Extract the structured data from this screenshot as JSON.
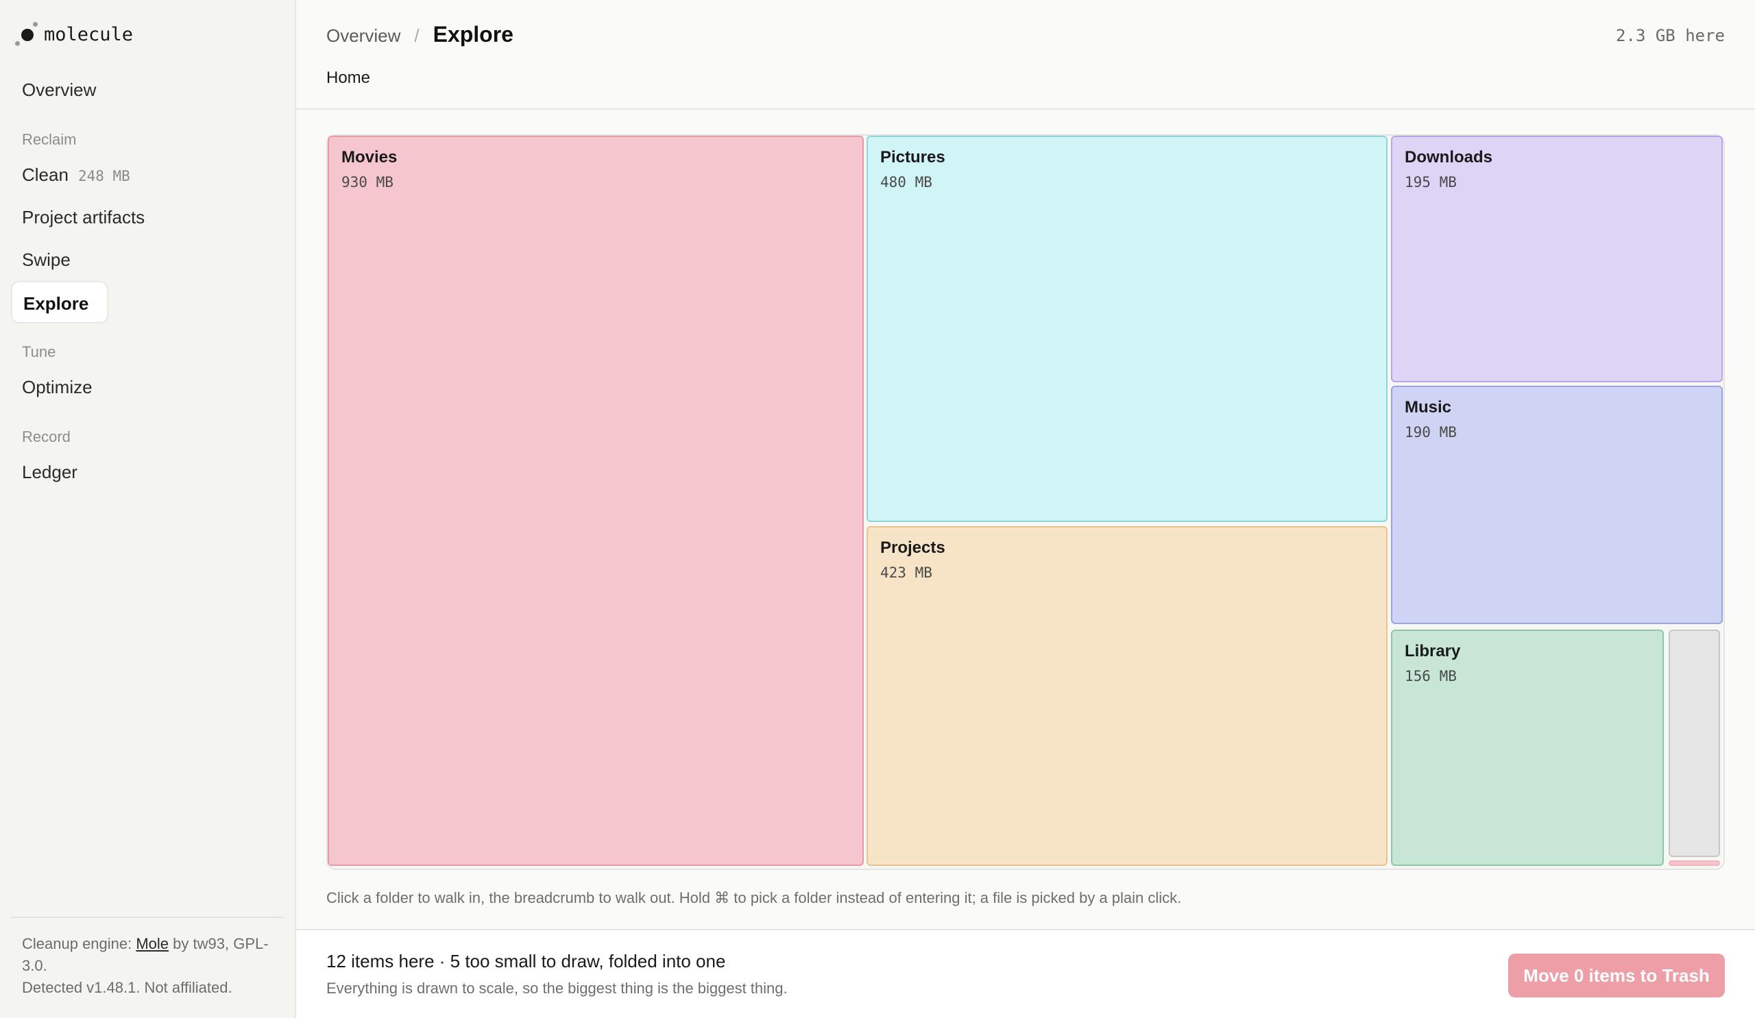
{
  "brand": {
    "name": "molecule"
  },
  "sidebar": {
    "overview": "Overview",
    "section_reclaim": "Reclaim",
    "clean": "Clean",
    "clean_badge": "248 MB",
    "project_artifacts": "Project artifacts",
    "swipe": "Swipe",
    "explore": "Explore",
    "section_tune": "Tune",
    "optimize": "Optimize",
    "section_record": "Record",
    "ledger": "Ledger",
    "footer": {
      "prefix": "Cleanup engine: ",
      "link": "Mole",
      "suffix": " by tw93, GPL-3.0.",
      "line2": "Detected v1.48.1. Not affiliated."
    }
  },
  "header": {
    "crumb_parent": "Overview",
    "crumb_sep": "/",
    "crumb_current": "Explore",
    "size_here": "2.3 GB here",
    "subcrumb": "Home"
  },
  "treemap": {
    "tiles": [
      {
        "name": "Movies",
        "size": "930 MB",
        "bg": "#f6c6cf",
        "border": "#e79aa5"
      },
      {
        "name": "Pictures",
        "size": "480 MB",
        "bg": "#d1f4f7",
        "border": "#8fd3dd"
      },
      {
        "name": "Projects",
        "size": "423 MB",
        "bg": "#f7e4c6",
        "border": "#e6c390"
      },
      {
        "name": "Downloads",
        "size": "195 MB",
        "bg": "#ddd4f6",
        "border": "#b5a6e6"
      },
      {
        "name": "Music",
        "size": "190 MB",
        "bg": "#cfd4f4",
        "border": "#9aa4e2"
      },
      {
        "name": "Library",
        "size": "156 MB",
        "bg": "#c8e6d5",
        "border": "#8fc7a6"
      },
      {
        "name": "",
        "size": "",
        "bg": "#e6e6e6",
        "border": "#c6c6c6"
      },
      {
        "name": "",
        "size": "",
        "bg": "#f6c6cf",
        "border": "#f0b4bd"
      }
    ]
  },
  "hint": "Click a folder to walk in, the breadcrumb to walk out. Hold ⌘ to pick a folder instead of entering it; a file is picked by a plain click.",
  "footer": {
    "title": "12 items here · 5 too small to draw, folded into one",
    "sub": "Everything is drawn to scale, so the biggest thing is the biggest thing.",
    "trash_button": "Move 0 items to Trash"
  }
}
